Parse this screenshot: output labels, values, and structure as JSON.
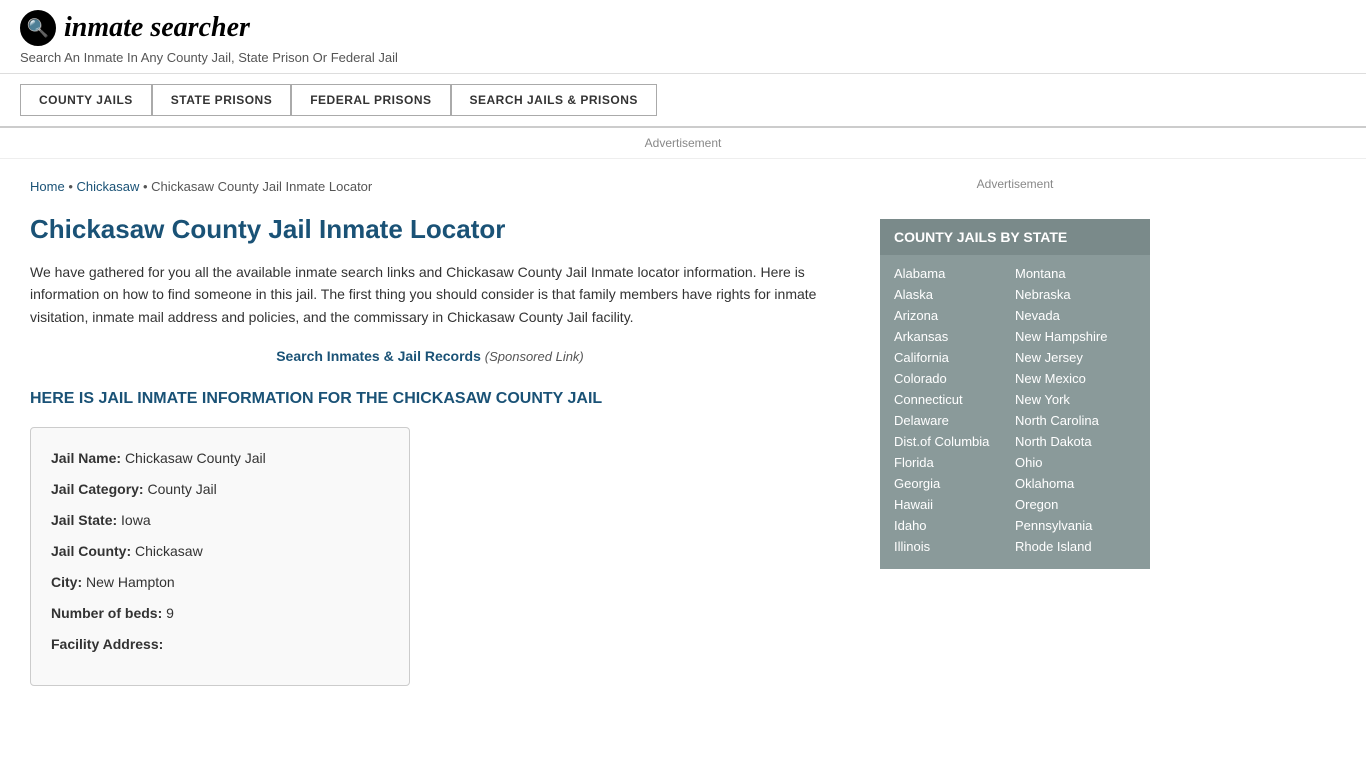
{
  "header": {
    "logo_icon": "🔍",
    "logo_text_1": "inmate",
    "logo_text_2": "searcher",
    "tagline": "Search An Inmate In Any County Jail, State Prison Or Federal Jail"
  },
  "nav": {
    "items": [
      {
        "label": "COUNTY JAILS",
        "id": "county-jails"
      },
      {
        "label": "STATE PRISONS",
        "id": "state-prisons"
      },
      {
        "label": "FEDERAL PRISONS",
        "id": "federal-prisons"
      },
      {
        "label": "SEARCH JAILS & PRISONS",
        "id": "search-jails"
      }
    ]
  },
  "ad_banner": "Advertisement",
  "breadcrumb": {
    "home": "Home",
    "separator": "•",
    "chickasaw_link": "Chickasaw",
    "current": "Chickasaw County Jail Inmate Locator"
  },
  "page_title": "Chickasaw County Jail Inmate Locator",
  "description": "We have gathered for you all the available inmate search links and Chickasaw County Jail Inmate locator information. Here is information on how to find someone in this jail. The first thing you should consider is that family members have rights for inmate visitation, inmate mail address and policies, and the commissary in Chickasaw County Jail facility.",
  "sponsored": {
    "link_text": "Search Inmates & Jail Records",
    "suffix": "(Sponsored Link)"
  },
  "info_heading": "HERE IS JAIL INMATE INFORMATION FOR THE CHICKASAW COUNTY JAIL",
  "info_box": {
    "jail_name_label": "Jail Name:",
    "jail_name_value": "Chickasaw County Jail",
    "jail_category_label": "Jail Category:",
    "jail_category_value": "County Jail",
    "jail_state_label": "Jail State:",
    "jail_state_value": "Iowa",
    "jail_county_label": "Jail County:",
    "jail_county_value": "Chickasaw",
    "city_label": "City:",
    "city_value": "New Hampton",
    "beds_label": "Number of beds:",
    "beds_value": "9",
    "facility_address_label": "Facility Address:"
  },
  "sidebar": {
    "ad_text": "Advertisement",
    "widget_title": "COUNTY JAILS BY STATE",
    "states_col1": [
      "Alabama",
      "Alaska",
      "Arizona",
      "Arkansas",
      "California",
      "Colorado",
      "Connecticut",
      "Delaware",
      "Dist.of Columbia",
      "Florida",
      "Georgia",
      "Hawaii",
      "Idaho",
      "Illinois"
    ],
    "states_col2": [
      "Montana",
      "Nebraska",
      "Nevada",
      "New Hampshire",
      "New Jersey",
      "New Mexico",
      "New York",
      "North Carolina",
      "North Dakota",
      "Ohio",
      "Oklahoma",
      "Oregon",
      "Pennsylvania",
      "Rhode Island"
    ]
  }
}
